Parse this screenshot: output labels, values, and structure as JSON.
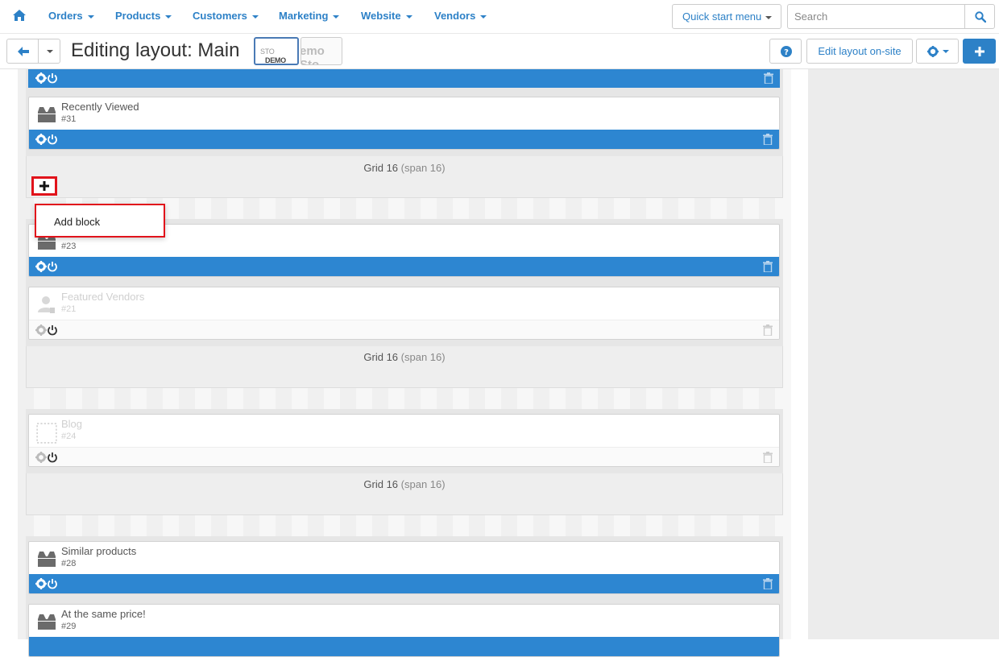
{
  "topnav": {
    "menus": [
      "Orders",
      "Products",
      "Customers",
      "Marketing",
      "Website",
      "Vendors"
    ],
    "quick_start": "Quick start menu",
    "search_placeholder": "Search"
  },
  "toolbar": {
    "title": "Editing layout: Main",
    "store_logo_a": {
      "text1": "DEMO",
      "text2": "STO"
    },
    "store_logo_b": "emo Sto",
    "edit_onsite": "Edit layout on-site"
  },
  "layout": {
    "grid_label": "Grid 16",
    "grid_span": "(span 16)",
    "blocks": [
      {
        "title": "Recently Viewed",
        "id": "#31",
        "enabled": true
      },
      {
        "title": "",
        "id": "#23",
        "enabled": true
      },
      {
        "title": "Featured Vendors",
        "id": "#21",
        "enabled": false
      },
      {
        "title": "Blog",
        "id": "#24",
        "enabled": false
      },
      {
        "title": "Similar products",
        "id": "#28",
        "enabled": true
      },
      {
        "title": "At the same price!",
        "id": "#29",
        "enabled": true
      }
    ],
    "add_block_menu_item": "Add block"
  },
  "colors": {
    "accent": "#2d81c7",
    "block_bar": "#2d86d1",
    "highlight": "#e1131b"
  }
}
